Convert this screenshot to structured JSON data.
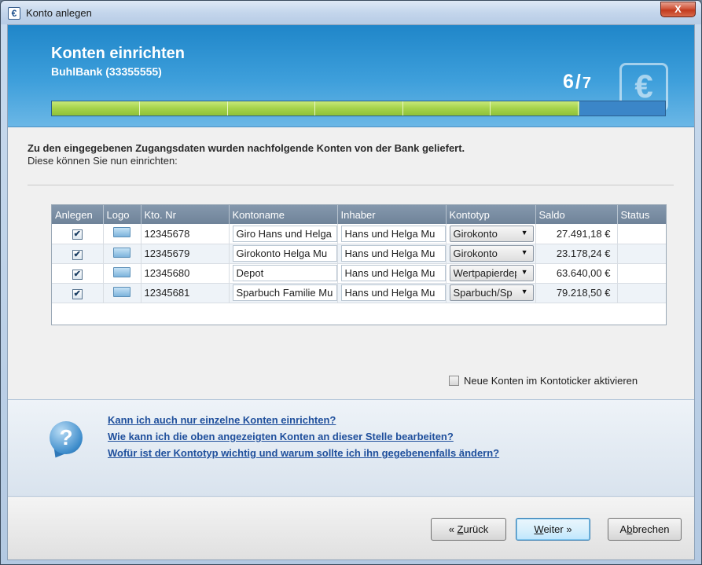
{
  "window": {
    "title": "Konto anlegen",
    "close_label": "X",
    "icon_glyph": "€"
  },
  "header": {
    "title": "Konten einrichten",
    "subtitle": "BuhlBank (33355555)",
    "step_current": "6",
    "step_slash": "/",
    "step_total": "7",
    "logo_glyph": "€",
    "progress_fraction": 0.86,
    "progress_segments": 7
  },
  "intro": {
    "bold": "Zu den eingegebenen Zugangsdaten wurden nachfolgende Konten von der Bank geliefert.",
    "text": "Diese können Sie nun einrichten:"
  },
  "table": {
    "columns": [
      "Anlegen",
      "Logo",
      "Kto. Nr",
      "Kontoname",
      "Inhaber",
      "Kontotyp",
      "Saldo",
      "Status"
    ],
    "rows": [
      {
        "checked": "✔",
        "kto": "12345678",
        "name": "Giro Hans und Helga",
        "inhaber": "Hans und Helga Mu",
        "typ": "Girokonto",
        "saldo": "27.491,18 €",
        "status": ""
      },
      {
        "checked": "✔",
        "kto": "12345679",
        "name": "Girokonto Helga Mu",
        "inhaber": "Hans und Helga Mu",
        "typ": "Girokonto",
        "saldo": "23.178,24 €",
        "status": ""
      },
      {
        "checked": "✔",
        "kto": "12345680",
        "name": "Depot",
        "inhaber": "Hans und Helga Mu",
        "typ": "Wertpapierdepot",
        "saldo": "63.640,00 €",
        "status": ""
      },
      {
        "checked": "✔",
        "kto": "12345681",
        "name": "Sparbuch Familie Mu",
        "inhaber": "Hans und Helga Mu",
        "typ": "Sparbuch/Sp",
        "saldo": "79.218,50 €",
        "status": ""
      }
    ]
  },
  "ticker": {
    "label": "Neue Konten im Kontoticker aktivieren",
    "checked": false
  },
  "help": {
    "icon_glyph": "?",
    "links": [
      "Kann ich auch nur einzelne Konten einrichten?",
      "Wie kann ich die oben angezeigten Konten an dieser Stelle bearbeiten?",
      "Wofür ist der Kontotyp wichtig und warum sollte ich ihn gegebenenfalls ändern?"
    ]
  },
  "footer": {
    "back": {
      "prefix": "« ",
      "mnemonic": "Z",
      "rest": "urück"
    },
    "next": {
      "mnemonic": "W",
      "rest": "eiter",
      "suffix": " »"
    },
    "cancel": {
      "pre": "A",
      "mnemonic": "b",
      "rest": "brechen"
    }
  },
  "colors": {
    "header_blue": "#2a8fd0",
    "progress_green": "#a5d24a",
    "link_blue": "#1f4f9c"
  }
}
